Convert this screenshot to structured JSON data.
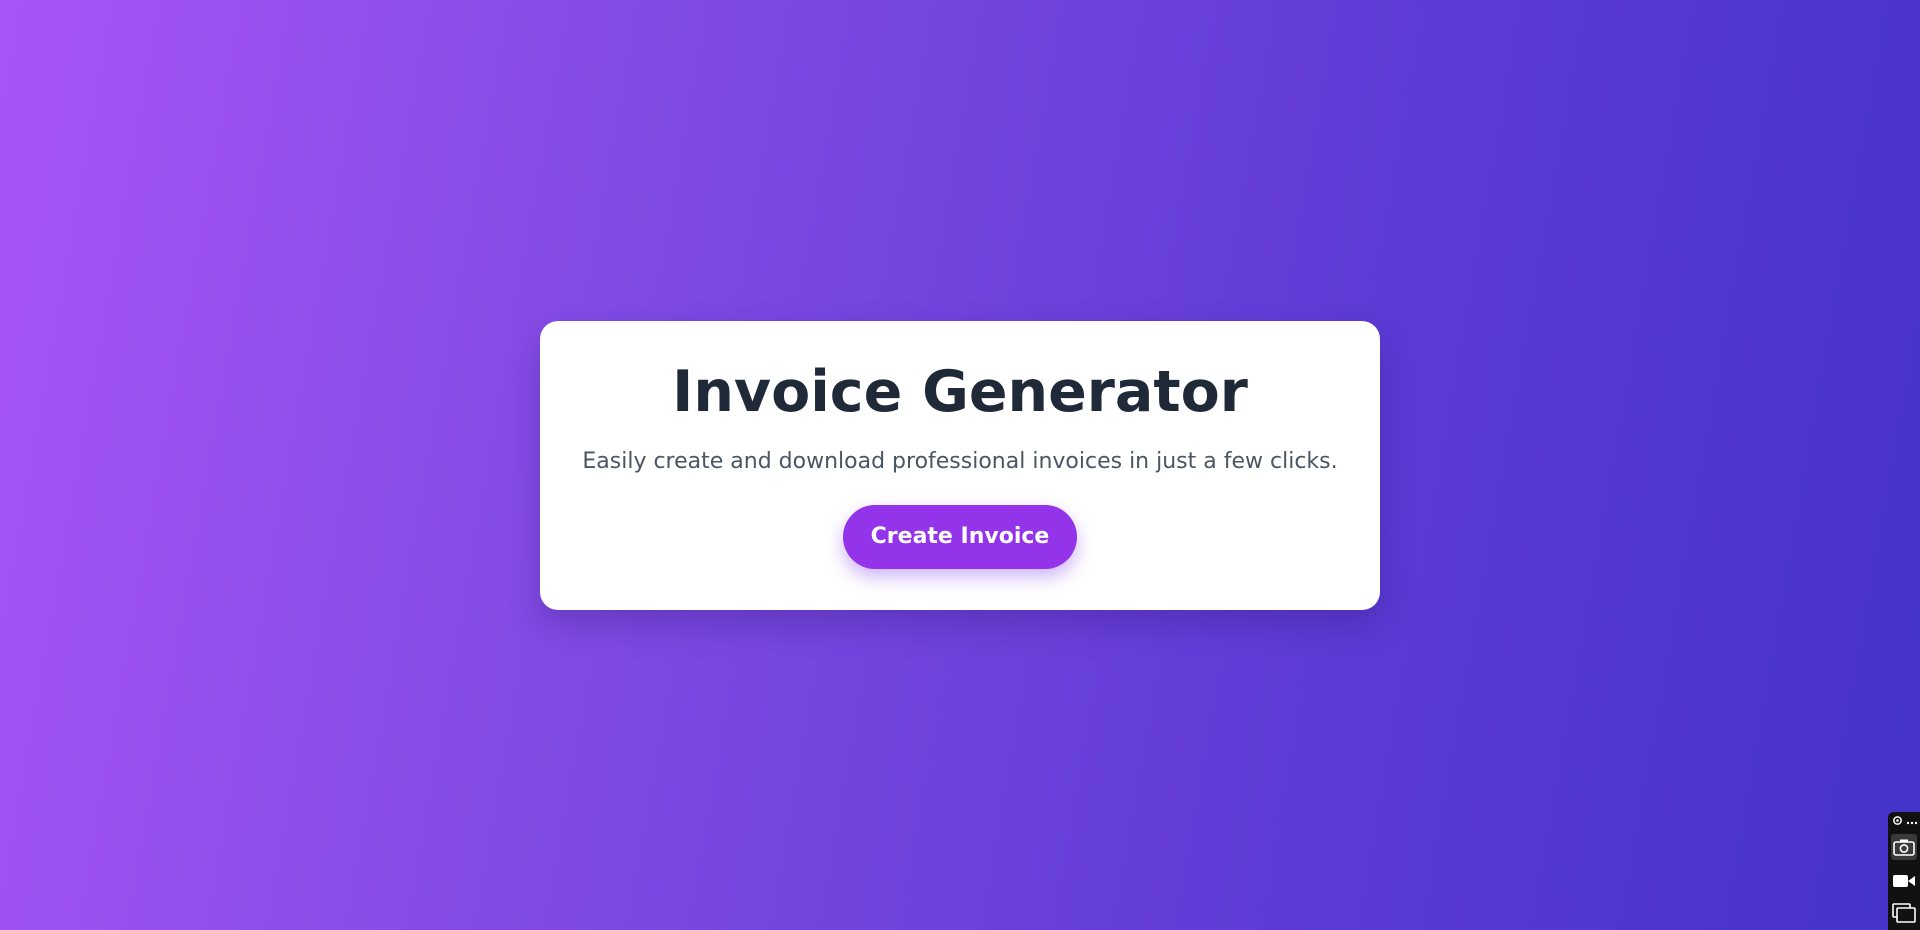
{
  "hero": {
    "title": "Invoice Generator",
    "subtitle": "Easily create and download professional invoices in just a few clicks.",
    "cta_label": "Create Invoice"
  },
  "colors": {
    "gradient_start": "#a855f7",
    "gradient_end": "#4533c9",
    "card_background": "#ffffff",
    "title": "#1f2937",
    "subtitle": "#4b5563",
    "button": "#9333ea",
    "button_text": "#ffffff"
  },
  "screen_capture_toolbar": {
    "icons": [
      "settings-icon",
      "more-icon",
      "screenshot-camera-icon",
      "video-record-icon",
      "window-capture-icon"
    ]
  }
}
